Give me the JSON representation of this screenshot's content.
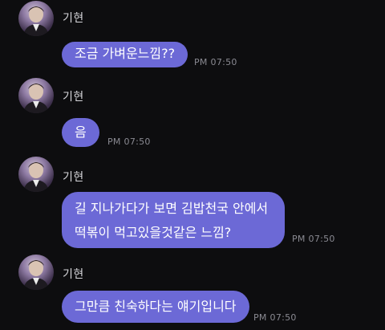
{
  "messages": [
    {
      "sender": "기현",
      "lines": [
        "조금 가벼운느낌??"
      ],
      "time": "PM 07:50"
    },
    {
      "sender": "기현",
      "lines": [
        "음"
      ],
      "time": "PM 07:50"
    },
    {
      "sender": "기현",
      "lines": [
        "길 지나가다가 보면 김밥천국 안에서",
        "떡볶이 먹고있을것같은 느낌?"
      ],
      "time": "PM 07:50"
    },
    {
      "sender": "기현",
      "lines": [
        "그만큼 친숙하다는 얘기입니다"
      ],
      "time": "PM 07:50"
    }
  ],
  "colors": {
    "background": "#0d0d0f",
    "bubble": "#6c69d6",
    "bubble_text": "#ffffff",
    "timestamp": "#8a8a92",
    "name": "#d7d7db"
  },
  "icons": {
    "avatar": "profile-photo"
  }
}
